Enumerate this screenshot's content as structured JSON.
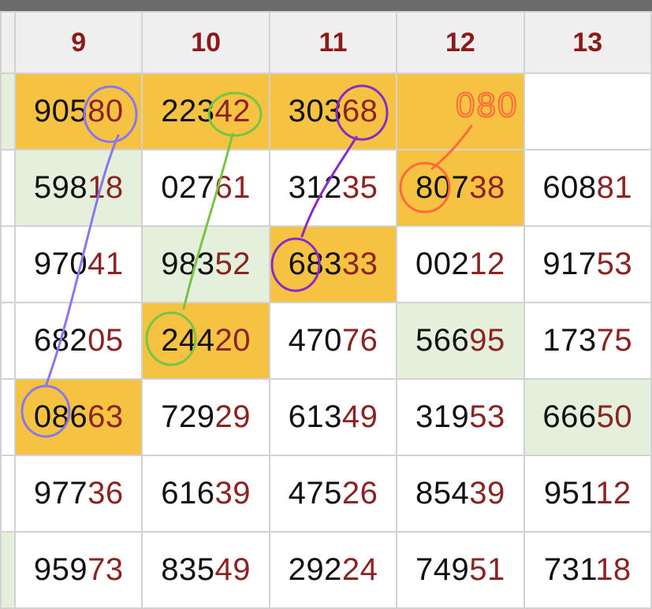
{
  "headers": [
    "9",
    "10",
    "11",
    "12",
    "13"
  ],
  "rows": [
    {
      "edge": "green",
      "cells": [
        {
          "head": "905",
          "tail": "80",
          "bg": "gold"
        },
        {
          "head": "223",
          "tail": "42",
          "bg": "gold"
        },
        {
          "head": "303",
          "tail": "68",
          "bg": "gold"
        },
        {
          "head": "",
          "tail": "",
          "bg": "gold"
        },
        {
          "head": "",
          "tail": "",
          "bg": "white"
        }
      ]
    },
    {
      "edge": "white",
      "cells": [
        {
          "head": "598",
          "tail": "18",
          "bg": "green"
        },
        {
          "head": "027",
          "tail": "61",
          "bg": "white"
        },
        {
          "head": "312",
          "tail": "35",
          "bg": "white"
        },
        {
          "head": "807",
          "tail": "38",
          "bg": "gold"
        },
        {
          "head": "608",
          "tail": "81",
          "bg": "white"
        }
      ]
    },
    {
      "edge": "white",
      "cells": [
        {
          "head": "970",
          "tail": "41",
          "bg": "white"
        },
        {
          "head": "983",
          "tail": "52",
          "bg": "green"
        },
        {
          "head": "683",
          "tail": "33",
          "bg": "gold"
        },
        {
          "head": "002",
          "tail": "12",
          "bg": "white"
        },
        {
          "head": "917",
          "tail": "53",
          "bg": "white"
        }
      ]
    },
    {
      "edge": "white",
      "cells": [
        {
          "head": "682",
          "tail": "05",
          "bg": "white"
        },
        {
          "head": "244",
          "tail": "20",
          "bg": "gold"
        },
        {
          "head": "470",
          "tail": "76",
          "bg": "white"
        },
        {
          "head": "566",
          "tail": "95",
          "bg": "green"
        },
        {
          "head": "173",
          "tail": "75",
          "bg": "white"
        }
      ]
    },
    {
      "edge": "white",
      "cells": [
        {
          "head": "086",
          "tail": "63",
          "bg": "gold"
        },
        {
          "head": "729",
          "tail": "29",
          "bg": "white"
        },
        {
          "head": "613",
          "tail": "49",
          "bg": "white"
        },
        {
          "head": "319",
          "tail": "53",
          "bg": "white"
        },
        {
          "head": "666",
          "tail": "50",
          "bg": "green"
        }
      ]
    },
    {
      "edge": "white",
      "cells": [
        {
          "head": "977",
          "tail": "36",
          "bg": "white"
        },
        {
          "head": "616",
          "tail": "39",
          "bg": "white"
        },
        {
          "head": "475",
          "tail": "26",
          "bg": "white"
        },
        {
          "head": "854",
          "tail": "39",
          "bg": "white"
        },
        {
          "head": "951",
          "tail": "12",
          "bg": "white"
        }
      ]
    },
    {
      "edge": "green",
      "cells": [
        {
          "head": "959",
          "tail": "73",
          "bg": "white"
        },
        {
          "head": "835",
          "tail": "49",
          "bg": "white"
        },
        {
          "head": "292",
          "tail": "24",
          "bg": "white"
        },
        {
          "head": "749",
          "tail": "51",
          "bg": "white"
        },
        {
          "head": "731",
          "tail": "18",
          "bg": "white"
        }
      ]
    }
  ],
  "annotations": {
    "handwritten_note": "080",
    "colors": {
      "blue": "#8877ee",
      "green": "#77c447",
      "purple": "#8a2bc9",
      "orange": "#ff6a3d"
    }
  }
}
